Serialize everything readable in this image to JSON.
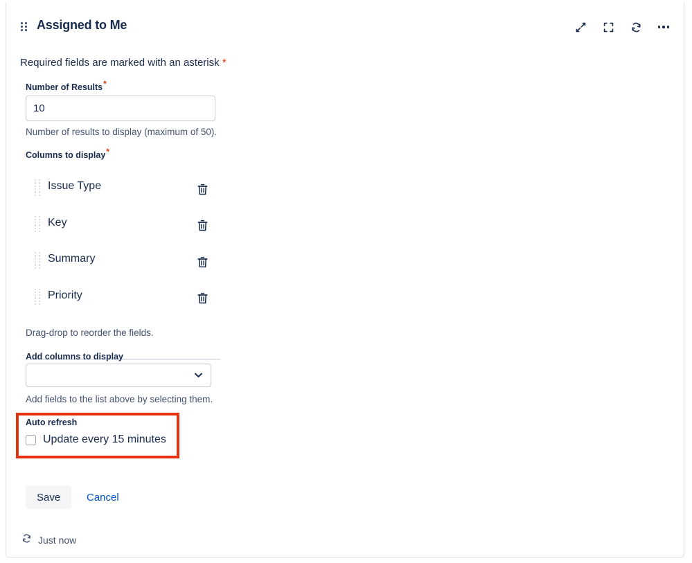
{
  "card": {
    "accent_color": "#2684ff",
    "title": "Assigned to Me",
    "drag_handle_icon": "drag-handle-icon",
    "header_actions": [
      {
        "name": "collapse-icon",
        "label": "Collapse"
      },
      {
        "name": "expand-icon",
        "label": "Expand"
      },
      {
        "name": "refresh-icon",
        "label": "Refresh"
      },
      {
        "name": "more-options-icon",
        "label": "More options"
      }
    ]
  },
  "form": {
    "required_note": "Required fields are marked with an asterisk",
    "asterisk": "*",
    "number_of_results": {
      "label": "Number of Results",
      "value": "10",
      "help": "Number of results to display (maximum of 50)."
    },
    "columns_to_display": {
      "label": "Columns to display",
      "items": [
        {
          "label": "Issue Type",
          "drag_icon": "drag-grid-icon",
          "delete_icon": "trash-icon"
        },
        {
          "label": "Key",
          "drag_icon": "drag-grid-icon",
          "delete_icon": "trash-icon"
        },
        {
          "label": "Summary",
          "drag_icon": "drag-grid-icon",
          "delete_icon": "trash-icon"
        },
        {
          "label": "Priority",
          "drag_icon": "drag-grid-icon",
          "delete_icon": "trash-icon"
        }
      ],
      "help": "Drag-drop to reorder the fields."
    },
    "add_columns": {
      "label": "Add columns to display",
      "selected": "",
      "placeholder": "",
      "chevron_icon": "chevron-down-icon",
      "help": "Add fields to the list above by selecting them."
    },
    "auto_refresh": {
      "label": "Auto refresh",
      "checkbox_label": "Update every 15 minutes",
      "checked": false,
      "highlight_color": "#e8320f"
    }
  },
  "actions": {
    "save_label": "Save",
    "cancel_label": "Cancel"
  },
  "footer": {
    "refresh_icon": "refresh-icon",
    "status": "Just now"
  }
}
